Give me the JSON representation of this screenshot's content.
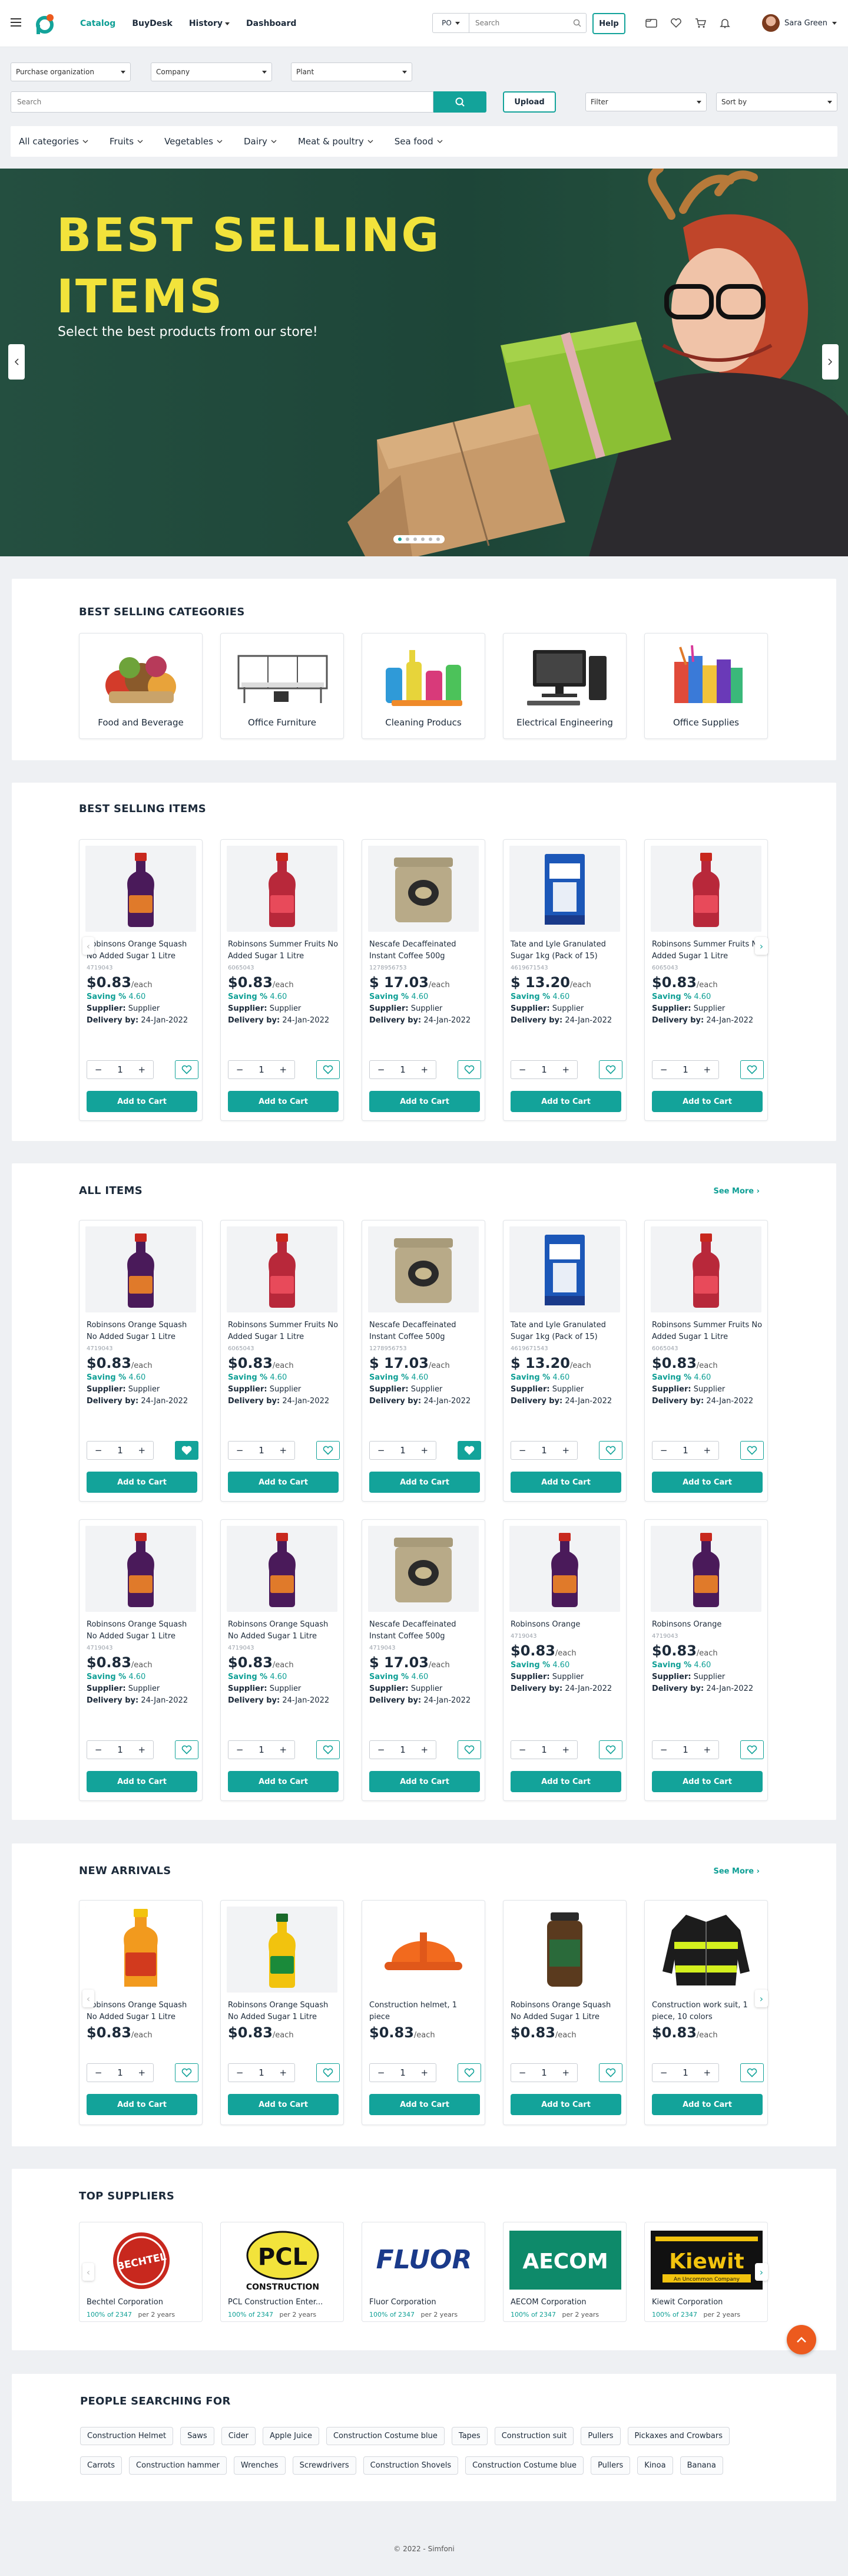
{
  "header": {
    "nav": [
      "Catalog",
      "BuyDesk",
      "History",
      "Dashboard"
    ],
    "po_label": "PO",
    "search_placeholder": "Search",
    "help_label": "Help",
    "user_name": "Sara Green"
  },
  "filters": {
    "purchase_org": "Purchase organization",
    "company": "Company",
    "plant": "Plant",
    "search_placeholder": "Search",
    "upload_label": "Upload",
    "filter_label": "Filter",
    "sort_label": "Sort by"
  },
  "categories_bar": [
    "All categories",
    "Fruits",
    "Vegetables",
    "Dairy",
    "Meat & poultry",
    "Sea food"
  ],
  "banner": {
    "title_line1": "BEST SELLING",
    "title_line2": "ITEMS",
    "subtitle": "Select the best products from our store!",
    "dots": 6
  },
  "best_categories": {
    "title": "BEST SELLING CATEGORIES",
    "items": [
      "Food and Beverage",
      "Office Furniture",
      "Cleaning Producs",
      "Electrical Engineering",
      "Office Supplies"
    ]
  },
  "labels": {
    "saving": "Saving %",
    "supplier": "Supplier:",
    "delivery": "Delivery by:",
    "each": "/each",
    "add_to_cart": "Add to Cart",
    "see_more": "See More",
    "minus": "−",
    "plus": "+"
  },
  "best_items": {
    "title": "BEST SELLING ITEMS",
    "items": [
      {
        "name": "Robinsons Orange Squash No Added Sugar 1 Litre",
        "code": "4719043",
        "price": "$0.83",
        "saving": "4.60",
        "supplier": "Supplier",
        "delivery": "24-Jan-2022",
        "qty": "1"
      },
      {
        "name": "Robinsons Summer Fruits No Added Sugar 1 Litre",
        "code": "6065043",
        "price": "$0.83",
        "saving": "4.60",
        "supplier": "Supplier",
        "delivery": "24-Jan-2022",
        "qty": "1"
      },
      {
        "name": "Nescafe Decaffeinated Instant Coffee 500g",
        "code": "1278956753",
        "price": "$ 17.03",
        "saving": "4.60",
        "supplier": "Supplier",
        "delivery": "24-Jan-2022",
        "qty": "1"
      },
      {
        "name": "Tate and Lyle Granulated Sugar 1kg (Pack of 15)",
        "code": "4619671543",
        "price": "$ 13.20",
        "saving": "4.60",
        "supplier": "Supplier",
        "delivery": "24-Jan-2022",
        "qty": "1"
      },
      {
        "name": "Robinsons Summer Fruits No Added Sugar 1 Litre",
        "code": "6065043",
        "price": "$0.83",
        "saving": "4.60",
        "supplier": "Supplier",
        "delivery": "24-Jan-2022",
        "qty": "1"
      }
    ]
  },
  "all_items": {
    "title": "ALL ITEMS",
    "items": [
      {
        "name": "Robinsons Orange Squash No Added Sugar 1 Litre",
        "code": "4719043",
        "price": "$0.83",
        "saving": "4.60",
        "supplier": "Supplier",
        "delivery": "24-Jan-2022",
        "qty": "1"
      },
      {
        "name": "Robinsons Summer Fruits No Added Sugar 1 Litre",
        "code": "6065043",
        "price": "$0.83",
        "saving": "4.60",
        "supplier": "Supplier",
        "delivery": "24-Jan-2022",
        "qty": "1"
      },
      {
        "name": "Nescafe Decaffeinated Instant Coffee 500g",
        "code": "1278956753",
        "price": "$ 17.03",
        "saving": "4.60",
        "supplier": "Supplier",
        "delivery": "24-Jan-2022",
        "qty": "1"
      },
      {
        "name": "Tate and Lyle Granulated Sugar 1kg (Pack of 15)",
        "code": "4619671543",
        "price": "$ 13.20",
        "saving": "4.60",
        "supplier": "Supplier",
        "delivery": "24-Jan-2022",
        "qty": "1"
      },
      {
        "name": "Robinsons Summer Fruits No Added Sugar 1 Litre",
        "code": "6065043",
        "price": "$0.83",
        "saving": "4.60",
        "supplier": "Supplier",
        "delivery": "24-Jan-2022",
        "qty": "1"
      },
      {
        "name": "Robinsons Orange Squash No Added Sugar 1 Litre",
        "code": "4719043",
        "price": "$0.83",
        "saving": "4.60",
        "supplier": "Supplier",
        "delivery": "24-Jan-2022",
        "qty": "1"
      },
      {
        "name": "Robinsons Orange Squash No Added Sugar 1 Litre",
        "code": "4719043",
        "price": "$0.83",
        "saving": "4.60",
        "supplier": "Supplier",
        "delivery": "24-Jan-2022",
        "qty": "1"
      },
      {
        "name": "Nescafe Decaffeinated Instant Coffee 500g",
        "code": "4719043",
        "price": "$ 17.03",
        "saving": "4.60",
        "supplier": "Supplier",
        "delivery": "24-Jan-2022",
        "qty": "1"
      },
      {
        "name": "Robinsons Orange",
        "code": "4719043",
        "price": "$0.83",
        "saving": "4.60",
        "supplier": "Supplier",
        "delivery": "24-Jan-2022",
        "qty": "1"
      },
      {
        "name": "Robinsons Orange",
        "code": "4719043",
        "price": "$0.83",
        "saving": "4.60",
        "supplier": "Supplier",
        "delivery": "24-Jan-2022",
        "qty": "1"
      }
    ]
  },
  "new_arrivals": {
    "title": "NEW ARRIVALS",
    "items": [
      {
        "name": "Robinsons Orange Squash No Added Sugar 1 Litre",
        "price": "$0.83",
        "qty": "1"
      },
      {
        "name": "Robinsons Orange Squash No Added Sugar 1 Litre",
        "price": "$0.83",
        "qty": "1"
      },
      {
        "name": "Construction helmet, 1 piece",
        "price": "$0.83",
        "qty": "1"
      },
      {
        "name": "Robinsons Orange Squash No Added Sugar 1 Litre",
        "price": "$0.83",
        "qty": "1"
      },
      {
        "name": "Construction work suit, 1 piece, 10 colors",
        "price": "$0.83",
        "qty": "1"
      }
    ]
  },
  "suppliers": {
    "title": "TOP SUPPLIERS",
    "items": [
      {
        "name": "Bechtel Corporation",
        "logo": "BECHTEL",
        "stat": "100% of 2347",
        "period": "per 2 years"
      },
      {
        "name": "PCL Construction Enter...",
        "logo": "PCL",
        "logo_sub": "CONSTRUCTION",
        "stat": "100% of 2347",
        "period": "per 2 years"
      },
      {
        "name": "Fluor Corporation",
        "logo": "FLUOR",
        "stat": "100% of 2347",
        "period": "per 2 years"
      },
      {
        "name": "AECOM Corporation",
        "logo": "AECOM",
        "stat": "100% of 2347",
        "period": "per 2 years"
      },
      {
        "name": "Kiewit Corporation",
        "logo": "Kiewit",
        "logo_sub": "An Uncommon Company",
        "stat": "100% of 2347",
        "period": "per 2 years"
      }
    ]
  },
  "searching": {
    "title": "PEOPLE SEARCHING FOR",
    "row1": [
      "Construction Helmet",
      "Saws",
      "Cider",
      "Apple Juice",
      "Construction Costume blue",
      "Tapes",
      "Construction suit",
      "Pullers",
      "Pickaxes and Crowbars"
    ],
    "row2": [
      "Carrots",
      "Construction hammer",
      "Wrenches",
      "Screwdrivers",
      "Construction Shovels",
      "Construction Costume blue",
      "Pullers",
      "Kinoa",
      "Banana"
    ]
  },
  "footer": {
    "text": "© 2022 - Simfoni"
  },
  "colors": {
    "accent": "#13a39a",
    "banner_bg": "#1f4d3d",
    "banner_title": "#f2e33b",
    "fab": "#ec5a1e"
  }
}
